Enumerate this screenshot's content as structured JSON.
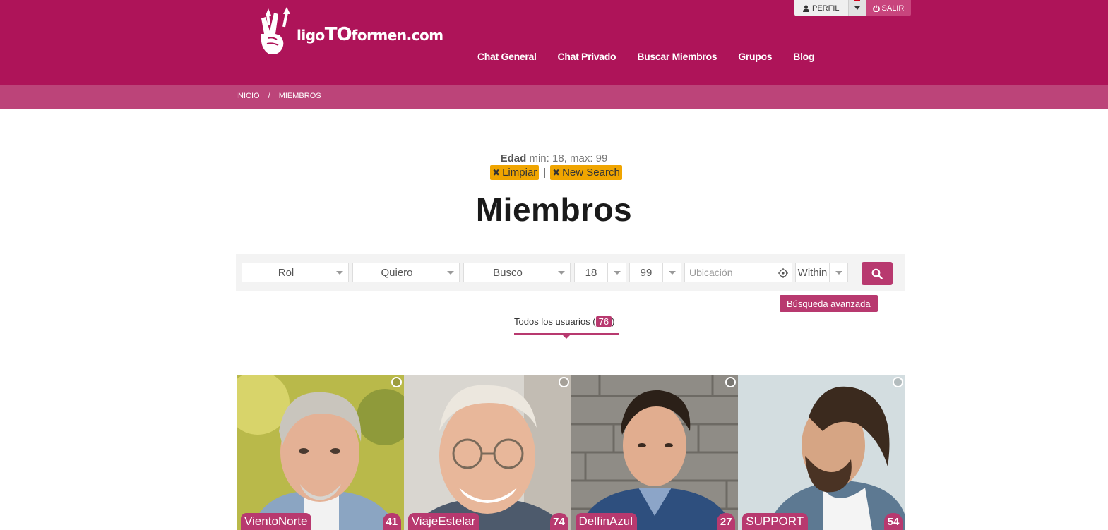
{
  "brand": {
    "logo_prefix": "ligo",
    "logo_mid": "TO",
    "logo_suffix": "formen.com"
  },
  "topbar": {
    "profile_label": "PERFIL",
    "logout_label": "SALIR"
  },
  "nav": {
    "items": [
      {
        "label": "Chat General"
      },
      {
        "label": "Chat Privado"
      },
      {
        "label": "Buscar Miembros"
      },
      {
        "label": "Grupos"
      },
      {
        "label": "Blog"
      }
    ]
  },
  "breadcrumb": {
    "home": "INICIO",
    "separator": "/",
    "current": "MIEMBROS"
  },
  "filter_summary": {
    "field": "Edad",
    "value": "min: 18, max: 99",
    "clear_label": "Limpiar",
    "divider": "|",
    "new_search_label": "New Search"
  },
  "page_title": "Miembros",
  "search": {
    "role": "Rol",
    "want": "Quiero",
    "seek": "Busco",
    "age_min": "18",
    "age_max": "99",
    "location_placeholder": "Ubicación",
    "within": "Within",
    "advanced_label": "Búsqueda avanzada"
  },
  "tabs": {
    "all_users_label": "Todos los usuarios (",
    "all_users_count": "76",
    "all_users_close": ")"
  },
  "members": [
    {
      "name": "VientoNorte",
      "age": "41"
    },
    {
      "name": "ViajeEstelar",
      "age": "74"
    },
    {
      "name": "DelfinAzul",
      "age": "27"
    },
    {
      "name": "SUPPORT",
      "age": "54"
    }
  ],
  "colors": {
    "brand": "#ae1459",
    "breadcrumb_bar": "#bc4479",
    "accent": "#b8396f",
    "tag": "#f0a500"
  }
}
